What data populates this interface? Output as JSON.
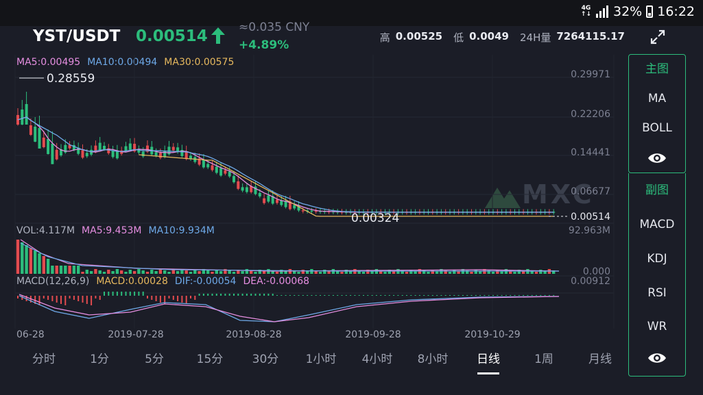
{
  "status_bar": {
    "network": "4G",
    "network_arrows": "↑↓",
    "battery": "32%",
    "time": "16:22"
  },
  "header": {
    "pair": "YST/USDT",
    "price": "0.00514",
    "cny": "≈0.035 CNY",
    "change": "+4.89%",
    "high_label": "高",
    "high_value": "0.00525",
    "low_label": "低",
    "low_value": "0.0049",
    "vol24_label": "24H量",
    "vol24_value": "7264115.17"
  },
  "colors": {
    "up": "#2cbd7c",
    "down": "#e34b4f",
    "ma5": "#e58ee0",
    "ma10": "#6ea9e8",
    "ma30": "#e6b85e",
    "background": "#1b1d27"
  },
  "main_legend": {
    "ma5": "MA5:0.00495",
    "ma10": "MA10:0.00494",
    "ma30": "MA30:0.00575"
  },
  "price_axis": [
    "0.29971",
    "0.22206",
    "0.14441",
    "0.06677"
  ],
  "current_price_tag": "0.00514",
  "max_label": "0.28559",
  "min_label": "0.00324",
  "volume_legend": {
    "vol": "VOL:4.117M",
    "ma5": "MA5:9.453M",
    "ma10": "MA10:9.934M"
  },
  "volume_axis": {
    "top": "92.963M",
    "bottom": "0.000"
  },
  "macd_legend": {
    "params": "MACD(12,26,9)",
    "macd": "MACD:0.00028",
    "dif": "DIF:-0.00054",
    "dea": "DEA:-0.00068"
  },
  "macd_axis": {
    "top": "0.00912"
  },
  "date_axis": [
    "06-28",
    "2019-07-28",
    "2019-08-28",
    "2019-09-28",
    "2019-10-29"
  ],
  "watermark": "MXC",
  "side_panel": {
    "main_title": "主图",
    "main_items": [
      "MA",
      "BOLL"
    ],
    "sub_title": "副图",
    "sub_items": [
      "MACD",
      "KDJ",
      "RSI",
      "WR"
    ]
  },
  "timeframes": [
    "分时",
    "1分",
    "5分",
    "15分",
    "30分",
    "1小时",
    "4小时",
    "8小时",
    "日线",
    "1周",
    "月线"
  ],
  "active_timeframe": "日线"
}
